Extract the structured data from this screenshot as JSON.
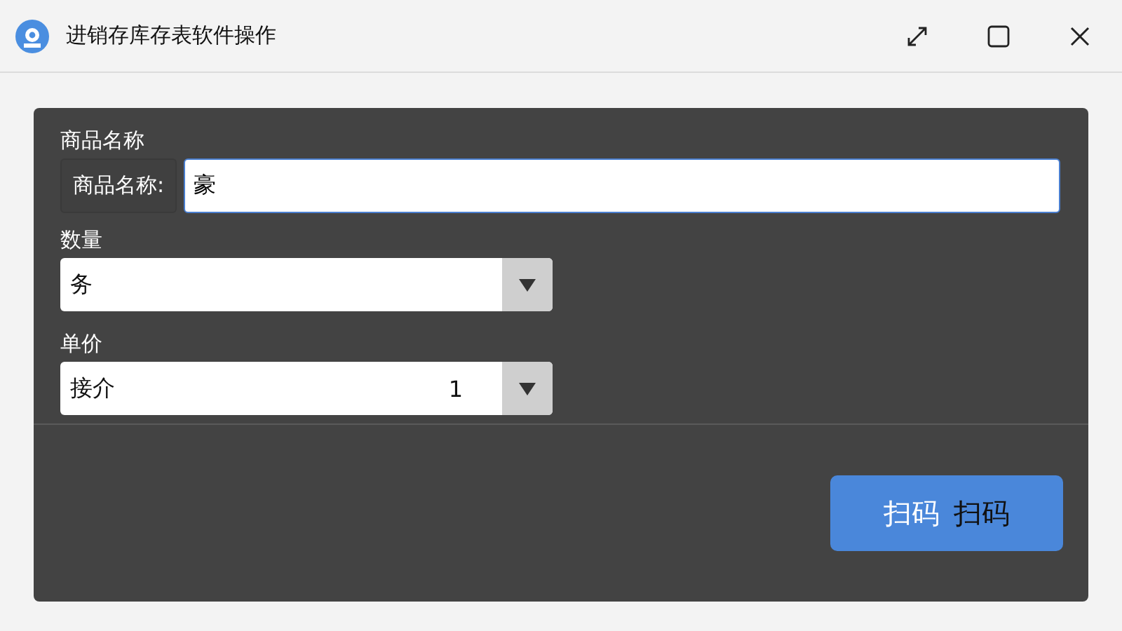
{
  "window": {
    "title": "进销存库存表软件操作"
  },
  "name_section": {
    "heading": "商品名称",
    "label": "商品名称:",
    "value": "豪"
  },
  "quantity_section": {
    "heading": "数量",
    "value": "务"
  },
  "price_section": {
    "heading": "单价",
    "value": "接介",
    "number": "1"
  },
  "scan_button": {
    "parts": [
      "扫码",
      "扫码"
    ]
  }
}
